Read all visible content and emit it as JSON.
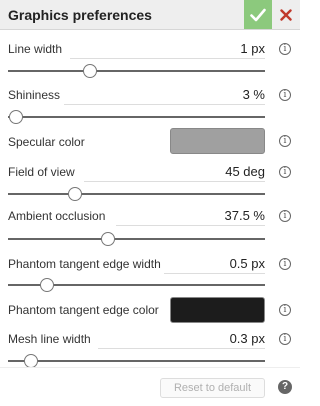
{
  "dialog": {
    "title": "Graphics preferences",
    "ok_icon": "check-icon",
    "close_icon": "close-icon",
    "accent_ok": "#8cc97d",
    "accent_close": "#c0392b"
  },
  "settings": {
    "line_width": {
      "label": "Line width",
      "value": "1 px",
      "slider_fraction": 0.32
    },
    "shininess": {
      "label": "Shininess",
      "value": "3 %",
      "slider_fraction": 0.03
    },
    "specular_color": {
      "label": "Specular color",
      "color": "#a0a0a0"
    },
    "field_of_view": {
      "label": "Field of view",
      "value": "45 deg",
      "slider_fraction": 0.26
    },
    "ambient_occlusion": {
      "label": "Ambient occlusion",
      "value": "37.5 %",
      "slider_fraction": 0.39
    },
    "phantom_tangent_edge_width": {
      "label": "Phantom tangent edge width",
      "value": "0.5 px",
      "slider_fraction": 0.15
    },
    "phantom_tangent_edge_color": {
      "label": "Phantom tangent edge color",
      "color": "#1c1c1c"
    },
    "mesh_line_width": {
      "label": "Mesh line width",
      "value": "0.3 px",
      "slider_fraction": 0.09
    }
  },
  "info_icon": "info-icon",
  "footer": {
    "reset_label": "Reset to default",
    "help_icon": "help-icon",
    "help_glyph": "?"
  }
}
